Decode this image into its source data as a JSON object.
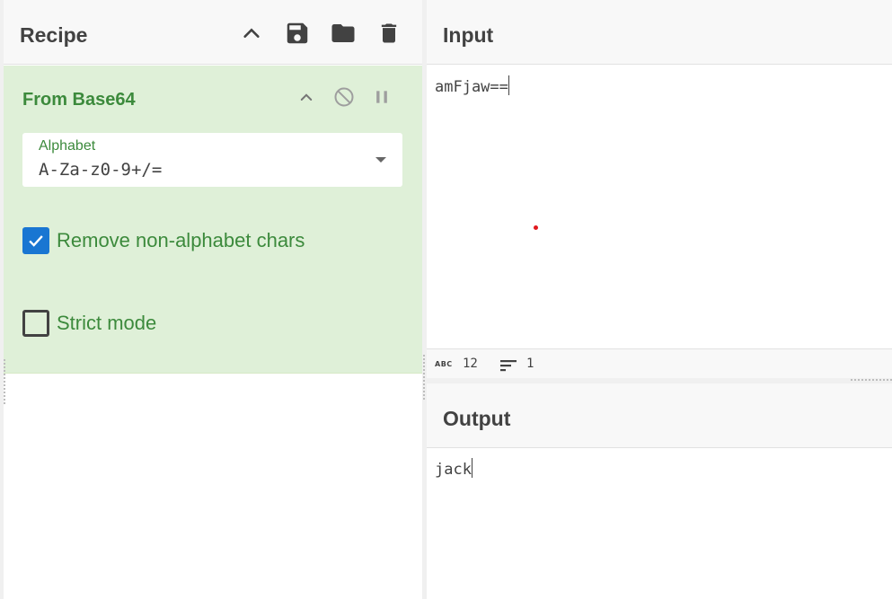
{
  "recipe": {
    "title": "Recipe",
    "icons": [
      "chevron-up-icon",
      "save-icon",
      "folder-icon",
      "trash-icon"
    ]
  },
  "operation": {
    "title": "From Base64",
    "icons": [
      "chevron-up-icon",
      "disable-icon",
      "pause-icon"
    ],
    "alphabet": {
      "label": "Alphabet",
      "value": "A-Za-z0-9+/="
    },
    "options": [
      {
        "label": "Remove non-alphabet chars",
        "checked": true
      },
      {
        "label": "Strict mode",
        "checked": false
      }
    ]
  },
  "input": {
    "title": "Input",
    "text": "amFjaw==",
    "status": {
      "abc_label": "ABC",
      "chars": "12",
      "lines": "1"
    }
  },
  "output": {
    "title": "Output",
    "text": "jack"
  },
  "colors": {
    "accent_green": "#3c8a3c",
    "op_background": "#dff0d8",
    "checkbox_blue": "#1976d2",
    "marker_red": "#e0191e"
  }
}
